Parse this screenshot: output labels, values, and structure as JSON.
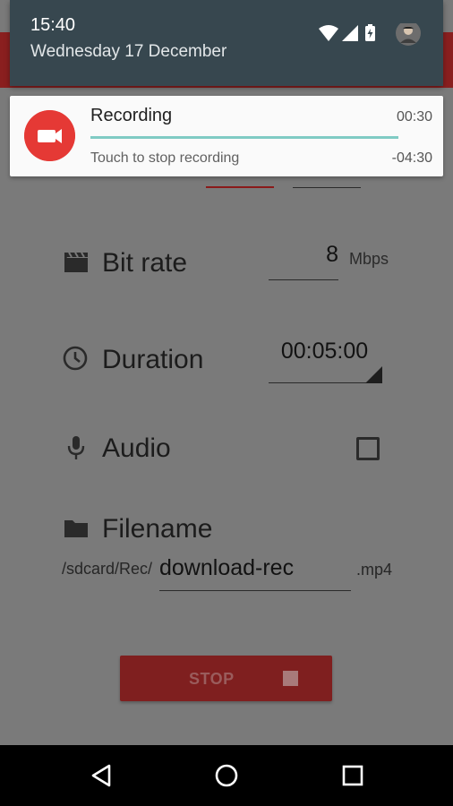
{
  "status_bar": {
    "time": "15:40",
    "date": "Wednesday 17 December",
    "icons": [
      "wifi-icon",
      "cell-signal-icon",
      "battery-charging-icon",
      "profile-avatar"
    ]
  },
  "notification": {
    "title": "Recording",
    "elapsed": "00:30",
    "subtitle": "Touch to stop recording",
    "remaining": "-04:30",
    "progress_fraction": 1.0,
    "icon_badge": "REC",
    "accent_color": "#e53935",
    "progress_color": "#80cbc4"
  },
  "settings": {
    "bitrate": {
      "label": "Bit rate",
      "value": "8",
      "unit": "Mbps",
      "icon": "movie-clapper-icon"
    },
    "duration": {
      "label": "Duration",
      "value": "00:05:00",
      "icon": "clock-icon"
    },
    "audio": {
      "label": "Audio",
      "checked": false,
      "icon": "microphone-icon"
    },
    "filename": {
      "label": "Filename",
      "prefix": "/sdcard/Rec/",
      "value": "download-rec",
      "extension": ".mp4",
      "icon": "folder-icon"
    }
  },
  "stop_button": {
    "label": "STOP"
  },
  "navigation": {
    "buttons": [
      "back-icon",
      "home-icon",
      "recents-icon"
    ]
  },
  "colors": {
    "shade": "#37474f",
    "app_accent": "#b71c1c"
  }
}
